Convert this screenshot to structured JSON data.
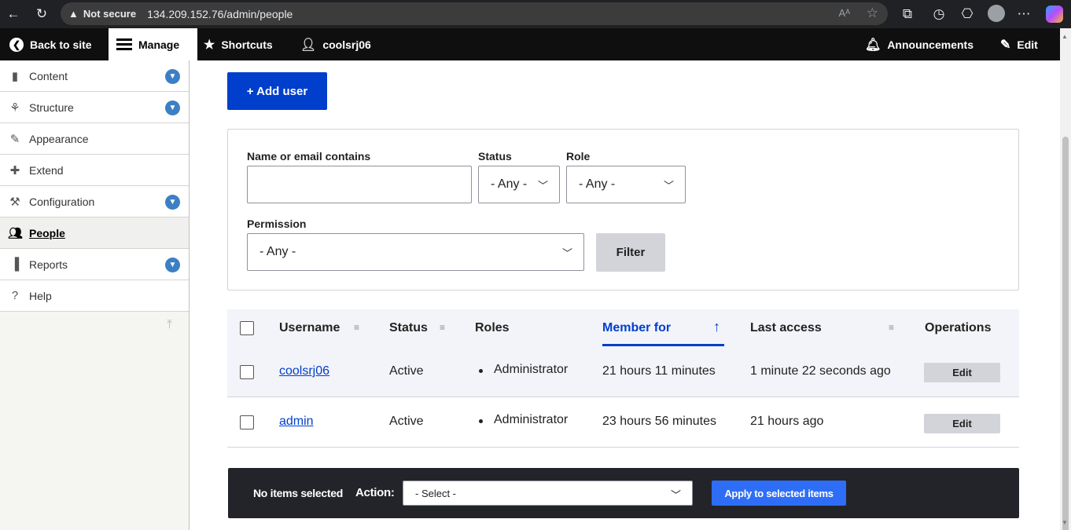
{
  "browser": {
    "not_secure": "Not secure",
    "url": "134.209.152.76/admin/people"
  },
  "toolbar": {
    "back": "Back to site",
    "manage": "Manage",
    "shortcuts": "Shortcuts",
    "user": "coolsrj06",
    "announcements": "Announcements",
    "edit": "Edit"
  },
  "sidebar": {
    "items": [
      {
        "label": "Content",
        "icon": "document-icon",
        "expandable": true
      },
      {
        "label": "Structure",
        "icon": "sitemap-icon",
        "expandable": true
      },
      {
        "label": "Appearance",
        "icon": "paintbrush-icon",
        "expandable": false
      },
      {
        "label": "Extend",
        "icon": "puzzle-icon",
        "expandable": false
      },
      {
        "label": "Configuration",
        "icon": "wrench-icon",
        "expandable": true
      },
      {
        "label": "People",
        "icon": "people-icon",
        "expandable": false,
        "active": true
      },
      {
        "label": "Reports",
        "icon": "bar-chart-icon",
        "expandable": true
      },
      {
        "label": "Help",
        "icon": "help-icon",
        "expandable": false
      }
    ]
  },
  "main": {
    "add_user": "+ Add user",
    "filters": {
      "name_label": "Name or email contains",
      "name_value": "",
      "status_label": "Status",
      "status_value": "- Any -",
      "role_label": "Role",
      "role_value": "- Any -",
      "permission_label": "Permission",
      "permission_value": "- Any -",
      "filter_button": "Filter"
    },
    "table": {
      "headers": {
        "username": "Username",
        "status": "Status",
        "roles": "Roles",
        "member_for": "Member for",
        "last_access": "Last access",
        "operations": "Operations"
      },
      "rows": [
        {
          "username": "coolsrj06",
          "status": "Active",
          "role": "Administrator",
          "member_for": "21 hours 11 minutes",
          "last_access": "1 minute 22 seconds ago",
          "op": "Edit"
        },
        {
          "username": "admin",
          "status": "Active",
          "role": "Administrator",
          "member_for": "23 hours 56 minutes",
          "last_access": "21 hours ago",
          "op": "Edit"
        }
      ]
    },
    "bulk": {
      "none_selected": "No items selected",
      "action_label": "Action:",
      "select_value": "- Select -",
      "apply": "Apply to selected items"
    }
  },
  "colors": {
    "accent": "#003ecc",
    "toolbar_bg": "#0f0f0f",
    "bulk_bg": "#232429",
    "apply_bg": "#2e6ef7"
  }
}
